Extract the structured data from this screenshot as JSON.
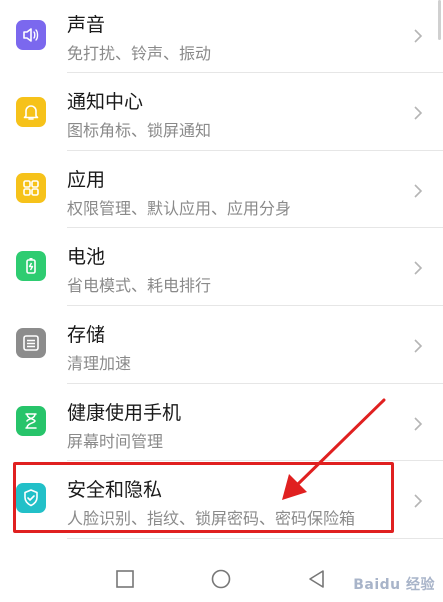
{
  "items": [
    {
      "title": "声音",
      "subtitle": "免打扰、铃声、振动",
      "icon": "speaker-icon",
      "color": "#7b68ee"
    },
    {
      "title": "通知中心",
      "subtitle": "图标角标、锁屏通知",
      "icon": "bell-icon",
      "color": "#f6c21a"
    },
    {
      "title": "应用",
      "subtitle": "权限管理、默认应用、应用分身",
      "icon": "apps-grid-icon",
      "color": "#f6c21a"
    },
    {
      "title": "电池",
      "subtitle": "省电模式、耗电排行",
      "icon": "battery-icon",
      "color": "#2ecc71"
    },
    {
      "title": "存储",
      "subtitle": "清理加速",
      "icon": "storage-icon",
      "color": "#8c8c8c"
    },
    {
      "title": "健康使用手机",
      "subtitle": "屏幕时间管理",
      "icon": "hourglass-icon",
      "color": "#27c46a"
    },
    {
      "title": "安全和隐私",
      "subtitle": "人脸识别、指纹、锁屏密码、密码保险箱",
      "icon": "shield-check-icon",
      "color": "#22c0c8"
    }
  ],
  "colors": {
    "highlight": "#e02020",
    "title": "#1a1a1a",
    "subtitle": "#8a8a8a"
  },
  "watermark": "Baidu 经验"
}
